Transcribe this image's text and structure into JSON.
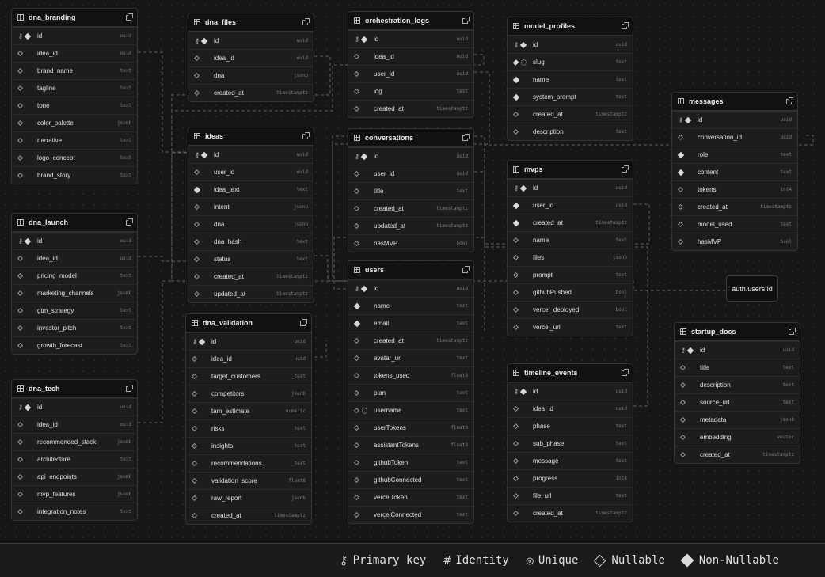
{
  "tables": [
    {
      "name": "dna_branding",
      "columns": [
        {
          "name": "id",
          "type": "uuid",
          "pk": true,
          "nullable": false
        },
        {
          "name": "idea_id",
          "type": "uuid",
          "nullable": true
        },
        {
          "name": "brand_name",
          "type": "text",
          "nullable": true
        },
        {
          "name": "tagline",
          "type": "text",
          "nullable": true
        },
        {
          "name": "tone",
          "type": "text",
          "nullable": true
        },
        {
          "name": "color_palette",
          "type": "jsonb",
          "nullable": true
        },
        {
          "name": "narrative",
          "type": "text",
          "nullable": true
        },
        {
          "name": "logo_concept",
          "type": "text",
          "nullable": true
        },
        {
          "name": "brand_story",
          "type": "text",
          "nullable": true
        }
      ]
    },
    {
      "name": "dna_files",
      "columns": [
        {
          "name": "id",
          "type": "uuid",
          "pk": true,
          "nullable": false
        },
        {
          "name": "idea_id",
          "type": "uuid",
          "nullable": true
        },
        {
          "name": "dna",
          "type": "jsonb",
          "nullable": true
        },
        {
          "name": "created_at",
          "type": "timestamptz",
          "nullable": true
        }
      ]
    },
    {
      "name": "orchestration_logs",
      "columns": [
        {
          "name": "id",
          "type": "uuid",
          "pk": true,
          "nullable": false
        },
        {
          "name": "idea_id",
          "type": "uuid",
          "nullable": true
        },
        {
          "name": "user_id",
          "type": "uuid",
          "nullable": true
        },
        {
          "name": "log",
          "type": "text",
          "nullable": true
        },
        {
          "name": "created_at",
          "type": "timestamptz",
          "nullable": true
        }
      ]
    },
    {
      "name": "model_profiles",
      "columns": [
        {
          "name": "id",
          "type": "uuid",
          "pk": true,
          "nullable": false
        },
        {
          "name": "slug",
          "type": "text",
          "nullable": false,
          "unique": true
        },
        {
          "name": "name",
          "type": "text",
          "nullable": false
        },
        {
          "name": "system_prompt",
          "type": "text",
          "nullable": false
        },
        {
          "name": "created_at",
          "type": "timestamptz",
          "nullable": true
        },
        {
          "name": "description",
          "type": "text",
          "nullable": true
        }
      ]
    },
    {
      "name": "messages",
      "columns": [
        {
          "name": "id",
          "type": "uuid",
          "pk": true,
          "nullable": false
        },
        {
          "name": "conversation_id",
          "type": "uuid",
          "nullable": true
        },
        {
          "name": "role",
          "type": "text",
          "nullable": false
        },
        {
          "name": "content",
          "type": "text",
          "nullable": false
        },
        {
          "name": "tokens",
          "type": "int4",
          "nullable": true
        },
        {
          "name": "created_at",
          "type": "timestamptz",
          "nullable": true
        },
        {
          "name": "model_used",
          "type": "text",
          "nullable": true
        },
        {
          "name": "hasMVP",
          "type": "bool",
          "nullable": true
        }
      ]
    },
    {
      "name": "ideas",
      "columns": [
        {
          "name": "id",
          "type": "uuid",
          "pk": true,
          "nullable": false
        },
        {
          "name": "user_id",
          "type": "uuid",
          "nullable": true
        },
        {
          "name": "idea_text",
          "type": "text",
          "nullable": false
        },
        {
          "name": "intent",
          "type": "jsonb",
          "nullable": true
        },
        {
          "name": "dna",
          "type": "jsonb",
          "nullable": true
        },
        {
          "name": "dna_hash",
          "type": "text",
          "nullable": true
        },
        {
          "name": "status",
          "type": "text",
          "nullable": true
        },
        {
          "name": "created_at",
          "type": "timestamptz",
          "nullable": true
        },
        {
          "name": "updated_at",
          "type": "timestamptz",
          "nullable": true
        }
      ]
    },
    {
      "name": "conversations",
      "columns": [
        {
          "name": "id",
          "type": "uuid",
          "pk": true,
          "nullable": false
        },
        {
          "name": "user_id",
          "type": "uuid",
          "nullable": true
        },
        {
          "name": "title",
          "type": "text",
          "nullable": true
        },
        {
          "name": "created_at",
          "type": "timestamptz",
          "nullable": true
        },
        {
          "name": "updated_at",
          "type": "timestamptz",
          "nullable": true
        },
        {
          "name": "hasMVP",
          "type": "bool",
          "nullable": true
        }
      ]
    },
    {
      "name": "mvps",
      "columns": [
        {
          "name": "id",
          "type": "uuid",
          "pk": true,
          "nullable": false
        },
        {
          "name": "user_id",
          "type": "uuid",
          "nullable": false
        },
        {
          "name": "created_at",
          "type": "timestamptz",
          "nullable": false
        },
        {
          "name": "name",
          "type": "text",
          "nullable": true
        },
        {
          "name": "files",
          "type": "jsonb",
          "nullable": true
        },
        {
          "name": "prompt",
          "type": "text",
          "nullable": true
        },
        {
          "name": "githubPushed",
          "type": "bool",
          "nullable": true
        },
        {
          "name": "vercel_deployed",
          "type": "bool",
          "nullable": true
        },
        {
          "name": "vercel_url",
          "type": "text",
          "nullable": true
        }
      ]
    },
    {
      "name": "dna_launch",
      "columns": [
        {
          "name": "id",
          "type": "uuid",
          "pk": true,
          "nullable": false
        },
        {
          "name": "idea_id",
          "type": "uuid",
          "nullable": true
        },
        {
          "name": "pricing_model",
          "type": "text",
          "nullable": true
        },
        {
          "name": "marketing_channels",
          "type": "jsonb",
          "nullable": true
        },
        {
          "name": "gtm_strategy",
          "type": "text",
          "nullable": true
        },
        {
          "name": "investor_pitch",
          "type": "text",
          "nullable": true
        },
        {
          "name": "growth_forecast",
          "type": "text",
          "nullable": true
        }
      ]
    },
    {
      "name": "users",
      "columns": [
        {
          "name": "id",
          "type": "uuid",
          "pk": true,
          "nullable": false
        },
        {
          "name": "name",
          "type": "text",
          "nullable": false
        },
        {
          "name": "email",
          "type": "text",
          "nullable": false
        },
        {
          "name": "created_at",
          "type": "timestamptz",
          "nullable": true
        },
        {
          "name": "avatar_url",
          "type": "text",
          "nullable": true
        },
        {
          "name": "tokens_used",
          "type": "float8",
          "nullable": true
        },
        {
          "name": "plan",
          "type": "text",
          "nullable": true
        },
        {
          "name": "username",
          "type": "text",
          "nullable": true,
          "unique": true
        },
        {
          "name": "userTokens",
          "type": "float8",
          "nullable": true
        },
        {
          "name": "assistantTokens",
          "type": "float8",
          "nullable": true
        },
        {
          "name": "githubToken",
          "type": "text",
          "nullable": true
        },
        {
          "name": "githubConnected",
          "type": "text",
          "nullable": true
        },
        {
          "name": "vercelToken",
          "type": "text",
          "nullable": true
        },
        {
          "name": "vercelConnected",
          "type": "text",
          "nullable": true
        }
      ]
    },
    {
      "name": "dna_validation",
      "columns": [
        {
          "name": "id",
          "type": "uuid",
          "pk": true,
          "nullable": false
        },
        {
          "name": "idea_id",
          "type": "uuid",
          "nullable": true
        },
        {
          "name": "target_customers",
          "type": "_text",
          "nullable": true
        },
        {
          "name": "competitors",
          "type": "jsonb",
          "nullable": true
        },
        {
          "name": "tam_estimate",
          "type": "numeric",
          "nullable": true
        },
        {
          "name": "risks",
          "type": "_text",
          "nullable": true
        },
        {
          "name": "insights",
          "type": "text",
          "nullable": true
        },
        {
          "name": "recommendations",
          "type": "_text",
          "nullable": true
        },
        {
          "name": "validation_score",
          "type": "float8",
          "nullable": true
        },
        {
          "name": "raw_report",
          "type": "jsonb",
          "nullable": true
        },
        {
          "name": "created_at",
          "type": "timestamptz",
          "nullable": true
        }
      ]
    },
    {
      "name": "startup_docs",
      "columns": [
        {
          "name": "id",
          "type": "uuid",
          "pk": true,
          "nullable": false
        },
        {
          "name": "title",
          "type": "text",
          "nullable": true
        },
        {
          "name": "description",
          "type": "text",
          "nullable": true
        },
        {
          "name": "source_url",
          "type": "text",
          "nullable": true
        },
        {
          "name": "metadata",
          "type": "jsonb",
          "nullable": true
        },
        {
          "name": "embedding",
          "type": "vector",
          "nullable": true
        },
        {
          "name": "created_at",
          "type": "timestamptz",
          "nullable": true
        }
      ]
    },
    {
      "name": "dna_tech",
      "columns": [
        {
          "name": "id",
          "type": "uuid",
          "pk": true,
          "nullable": false
        },
        {
          "name": "idea_id",
          "type": "uuid",
          "nullable": true
        },
        {
          "name": "recommended_stack",
          "type": "jsonb",
          "nullable": true
        },
        {
          "name": "architecture",
          "type": "text",
          "nullable": true
        },
        {
          "name": "api_endpoints",
          "type": "jsonb",
          "nullable": true
        },
        {
          "name": "mvp_features",
          "type": "jsonb",
          "nullable": true
        },
        {
          "name": "integration_notes",
          "type": "text",
          "nullable": true
        }
      ]
    },
    {
      "name": "timeline_events",
      "columns": [
        {
          "name": "id",
          "type": "uuid",
          "pk": true,
          "nullable": false
        },
        {
          "name": "idea_id",
          "type": "uuid",
          "nullable": true
        },
        {
          "name": "phase",
          "type": "text",
          "nullable": true
        },
        {
          "name": "sub_phase",
          "type": "text",
          "nullable": true
        },
        {
          "name": "message",
          "type": "text",
          "nullable": true
        },
        {
          "name": "progress",
          "type": "int4",
          "nullable": true
        },
        {
          "name": "file_url",
          "type": "text",
          "nullable": true
        },
        {
          "name": "created_at",
          "type": "timestamptz",
          "nullable": true
        }
      ]
    }
  ],
  "external_node": {
    "label": "auth.users.id"
  },
  "legend": [
    {
      "icon": "key-icon",
      "label": "Primary key"
    },
    {
      "icon": "hash-icon",
      "label": "Identity"
    },
    {
      "icon": "fingerprint-icon",
      "label": "Unique"
    },
    {
      "icon": "diamond-outline-icon",
      "label": "Nullable"
    },
    {
      "icon": "diamond-filled-icon",
      "label": "Non-Nullable"
    }
  ]
}
